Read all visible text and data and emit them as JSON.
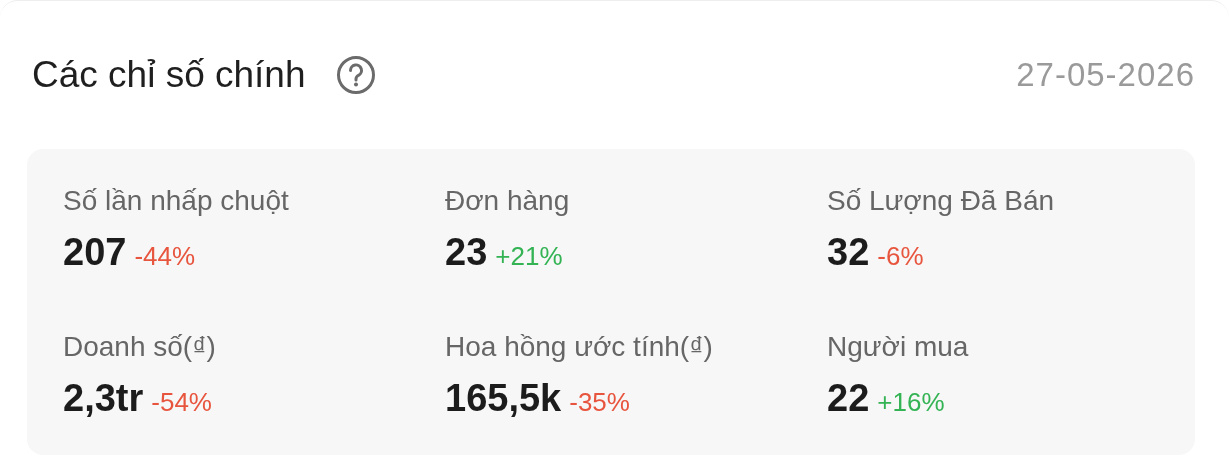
{
  "header": {
    "title": "Các chỉ số chính",
    "date": "27-05-2026"
  },
  "metrics": [
    {
      "label": "Số lần nhấp chuột",
      "value": "207",
      "change": "-44%",
      "color": "#e8553e"
    },
    {
      "label": "Đơn hàng",
      "value": "23",
      "change": "+21%",
      "color": "#33b353"
    },
    {
      "label": "Số Lượng Đã Bán",
      "value": "32",
      "change": "-6%",
      "color": "#e8553e"
    },
    {
      "label": "Doanh số(₫)",
      "value": "2,3tr",
      "change": "-54%",
      "color": "#e8553e"
    },
    {
      "label": "Hoa hồng ước tính(₫)",
      "value": "165,5k",
      "change": "-35%",
      "color": "#e8553e"
    },
    {
      "label": "Người mua",
      "value": "22",
      "change": "+16%",
      "color": "#33b353"
    }
  ]
}
